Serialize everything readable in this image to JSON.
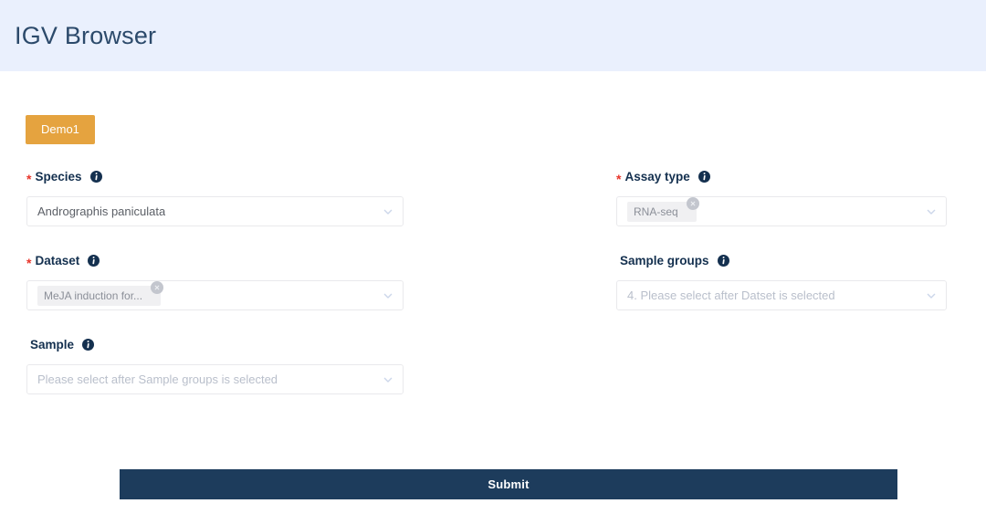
{
  "header": {
    "title": "IGV Browser",
    "background_color": "#eaf0fd",
    "title_color": "#2c4a6b"
  },
  "tabs": [
    {
      "label": "Demo1",
      "active": true,
      "color": "#e5a33f"
    }
  ],
  "form": {
    "left_column": [
      {
        "key": "species",
        "label": "Species",
        "required": true,
        "required_marker": "*",
        "info_icon": "info-circle-icon",
        "control": "select",
        "value": "Andrographis paniculata",
        "placeholder": "",
        "chevron_icon": "chevron-down-icon"
      },
      {
        "key": "dataset",
        "label": "Dataset",
        "required": true,
        "required_marker": "*",
        "info_icon": "info-circle-icon",
        "control": "multiselect-tag",
        "tag": "MeJA induction for...",
        "tag_close_icon": "close-circle-icon",
        "chevron_icon": "chevron-down-icon"
      },
      {
        "key": "sample",
        "label": "Sample",
        "required": false,
        "required_marker": "",
        "info_icon": "info-circle-icon",
        "control": "select",
        "value": "",
        "placeholder": "Please select after Sample groups is selected",
        "chevron_icon": "chevron-down-icon"
      }
    ],
    "right_column": [
      {
        "key": "assay_type",
        "label": "Assay type",
        "required": true,
        "required_marker": "*",
        "info_icon": "info-circle-icon",
        "control": "multiselect-tag",
        "tag": "RNA-seq",
        "tag_close_icon": "close-circle-icon",
        "chevron_icon": "chevron-down-icon"
      },
      {
        "key": "sample_groups",
        "label": "Sample groups",
        "required": false,
        "required_marker": "",
        "info_icon": "info-circle-icon",
        "control": "select",
        "value": "",
        "placeholder": "4. Please select after Datset is selected",
        "chevron_icon": "chevron-down-icon"
      }
    ]
  },
  "submit": {
    "label": "Submit",
    "background_color": "#1d3c5c",
    "text_color": "#ffffff"
  },
  "colors": {
    "required_star": "#e8352b",
    "label": "#14304f",
    "placeholder": "#b9bfcb",
    "value": "#5b5f66",
    "border": "#e9e9ec",
    "tag_bg": "#f0f0f2"
  }
}
